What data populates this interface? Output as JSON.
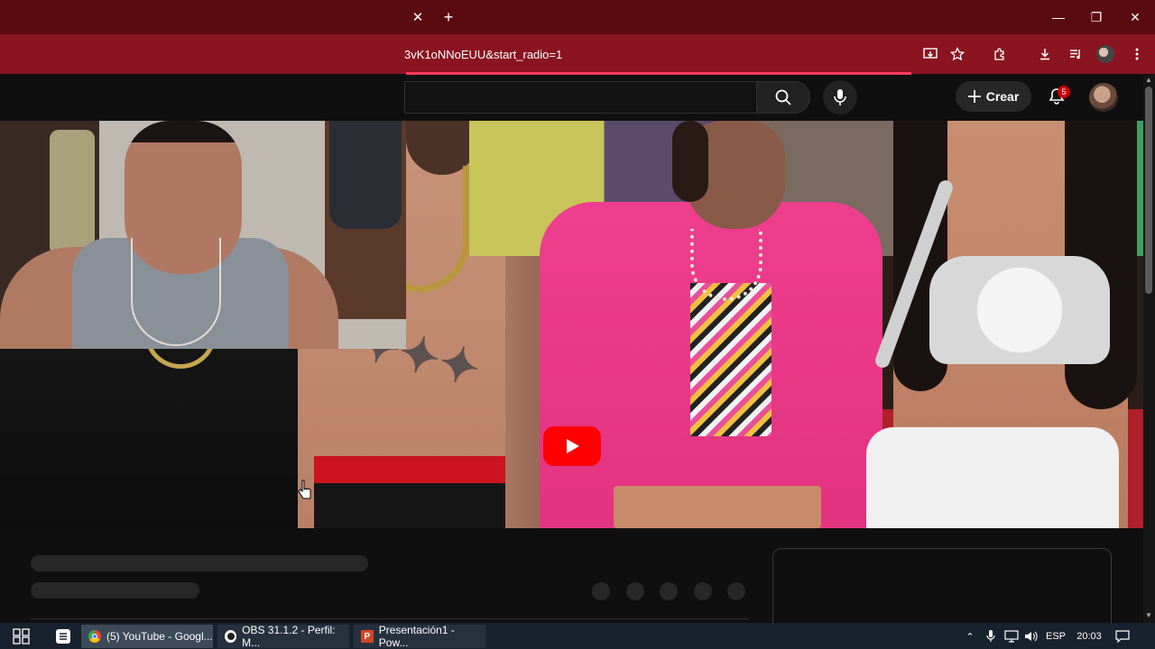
{
  "browser": {
    "url_partial": "3vK1oNNoEUU&start_radio=1",
    "tab_close_icon": "✕",
    "new_tab_icon": "+",
    "window_controls": [
      "—",
      "❐",
      "✕"
    ]
  },
  "youtube": {
    "create_label": "Crear",
    "notification_count": "5"
  },
  "taskbar": {
    "apps": [
      {
        "label": "(5) YouTube - Googl...",
        "icon": "chrome-icon"
      },
      {
        "label": "OBS 31.1.2 - Perfil: M...",
        "icon": "obs-icon"
      },
      {
        "label": "Presentación1 - Pow...",
        "icon": "powerpoint-icon"
      }
    ],
    "language": "ESP",
    "time": "20:03"
  },
  "colors": {
    "titlebar": "#5a0a12",
    "addressbar": "#8a1420",
    "youtube_red": "#ff0000"
  }
}
